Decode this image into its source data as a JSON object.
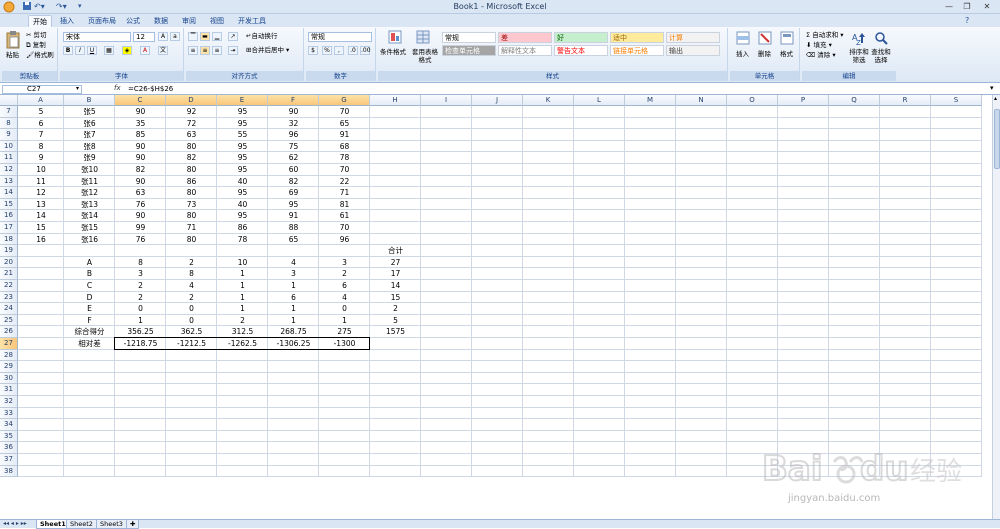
{
  "window": {
    "title": "Book1 - Microsoft Excel"
  },
  "tabs": [
    "开始",
    "插入",
    "页面布局",
    "公式",
    "数据",
    "审阅",
    "视图",
    "开发工具"
  ],
  "ribbon": {
    "clipboard": {
      "label": "剪贴板",
      "paste": "粘贴",
      "cut": "剪切",
      "copy": "复制",
      "format_painter": "格式刷"
    },
    "font": {
      "label": "字体",
      "font_name": "宋体",
      "font_size": "12"
    },
    "alignment": {
      "label": "对齐方式",
      "wrap": "自动换行",
      "merge": "合并后居中"
    },
    "number": {
      "label": "数字",
      "format": "常规"
    },
    "styles": {
      "label": "样式",
      "conditional": "条件格式",
      "table_format": "套用表格格式",
      "cells": [
        {
          "name": "常规",
          "bg": "#ffffff",
          "fg": "#000000"
        },
        {
          "name": "差",
          "bg": "#ffc7ce",
          "fg": "#9c0006"
        },
        {
          "name": "好",
          "bg": "#c6efce",
          "fg": "#006100"
        },
        {
          "name": "适中",
          "bg": "#ffeb9c",
          "fg": "#9c6500"
        },
        {
          "name": "计算",
          "bg": "#f2f2f2",
          "fg": "#fa7d00"
        },
        {
          "name": "检查单元格",
          "bg": "#a5a5a5",
          "fg": "#ffffff"
        },
        {
          "name": "解释性文本",
          "bg": "#ffffff",
          "fg": "#7f7f7f"
        },
        {
          "name": "警告文本",
          "bg": "#ffffff",
          "fg": "#ff0000"
        },
        {
          "name": "链接单元格",
          "bg": "#ffffff",
          "fg": "#fa7d00"
        },
        {
          "name": "输出",
          "bg": "#f2f2f2",
          "fg": "#3f3f3f"
        }
      ]
    },
    "cells_group": {
      "label": "单元格",
      "insert": "插入",
      "delete": "删除",
      "format": "格式"
    },
    "editing": {
      "label": "编辑",
      "autosum": "自动求和",
      "fill": "填充",
      "clear": "清除",
      "sort": "排序和筛选",
      "find": "查找和选择"
    }
  },
  "formula_bar": {
    "name_box": "C27",
    "fx": "fx",
    "formula": "=C26-$H$26"
  },
  "columns": [
    "A",
    "B",
    "C",
    "D",
    "E",
    "F",
    "G",
    "H",
    "I",
    "J",
    "K",
    "L",
    "M",
    "N",
    "O",
    "P",
    "Q",
    "R",
    "S"
  ],
  "rows": [
    {
      "n": "7",
      "A": "5",
      "B": "张5",
      "C": "90",
      "D": "92",
      "E": "95",
      "F": "90",
      "G": "70"
    },
    {
      "n": "8",
      "A": "6",
      "B": "张6",
      "C": "35",
      "D": "72",
      "E": "95",
      "F": "32",
      "G": "65"
    },
    {
      "n": "9",
      "A": "7",
      "B": "张7",
      "C": "85",
      "D": "63",
      "E": "55",
      "F": "96",
      "G": "91"
    },
    {
      "n": "10",
      "A": "8",
      "B": "张8",
      "C": "90",
      "D": "80",
      "E": "95",
      "F": "75",
      "G": "68"
    },
    {
      "n": "11",
      "A": "9",
      "B": "张9",
      "C": "90",
      "D": "82",
      "E": "95",
      "F": "62",
      "G": "78"
    },
    {
      "n": "12",
      "A": "10",
      "B": "张10",
      "C": "82",
      "D": "80",
      "E": "95",
      "F": "60",
      "G": "70"
    },
    {
      "n": "13",
      "A": "11",
      "B": "张11",
      "C": "90",
      "D": "86",
      "E": "40",
      "F": "82",
      "G": "22"
    },
    {
      "n": "14",
      "A": "12",
      "B": "张12",
      "C": "63",
      "D": "80",
      "E": "95",
      "F": "69",
      "G": "71"
    },
    {
      "n": "15",
      "A": "13",
      "B": "张13",
      "C": "76",
      "D": "73",
      "E": "40",
      "F": "95",
      "G": "81"
    },
    {
      "n": "16",
      "A": "14",
      "B": "张14",
      "C": "90",
      "D": "80",
      "E": "95",
      "F": "91",
      "G": "61"
    },
    {
      "n": "17",
      "A": "15",
      "B": "张15",
      "C": "99",
      "D": "71",
      "E": "86",
      "F": "88",
      "G": "70"
    },
    {
      "n": "18",
      "A": "16",
      "B": "张16",
      "C": "76",
      "D": "80",
      "E": "78",
      "F": "65",
      "G": "96"
    },
    {
      "n": "19",
      "H": "合计"
    },
    {
      "n": "20",
      "B": "A",
      "C": "8",
      "D": "2",
      "E": "10",
      "F": "4",
      "G": "3",
      "H": "27"
    },
    {
      "n": "21",
      "B": "B",
      "C": "3",
      "D": "8",
      "E": "1",
      "F": "3",
      "G": "2",
      "H": "17"
    },
    {
      "n": "22",
      "B": "C",
      "C": "2",
      "D": "4",
      "E": "1",
      "F": "1",
      "G": "6",
      "H": "14"
    },
    {
      "n": "23",
      "B": "D",
      "C": "2",
      "D": "2",
      "E": "1",
      "F": "6",
      "G": "4",
      "H": "15"
    },
    {
      "n": "24",
      "B": "E",
      "C": "0",
      "D": "0",
      "E": "1",
      "F": "1",
      "G": "0",
      "H": "2"
    },
    {
      "n": "25",
      "B": "F",
      "C": "1",
      "D": "0",
      "E": "2",
      "F": "1",
      "G": "1",
      "H": "5"
    },
    {
      "n": "26",
      "B": "综合得分",
      "C": "356.25",
      "D": "362.5",
      "E": "312.5",
      "F": "268.75",
      "G": "275",
      "H": "1575"
    },
    {
      "n": "27",
      "B": "相对差",
      "C": "-1218.75",
      "D": "-1212.5",
      "E": "-1262.5",
      "F": "-1306.25",
      "G": "-1300"
    },
    {
      "n": "28"
    },
    {
      "n": "29"
    },
    {
      "n": "30"
    },
    {
      "n": "31"
    },
    {
      "n": "32"
    },
    {
      "n": "33"
    },
    {
      "n": "34"
    },
    {
      "n": "35"
    },
    {
      "n": "36"
    },
    {
      "n": "37"
    },
    {
      "n": "38"
    }
  ],
  "sheets": [
    "Sheet1",
    "Sheet2",
    "Sheet3"
  ],
  "watermark": {
    "logo": "Baidu经验",
    "url": "jingyan.baidu.com"
  }
}
